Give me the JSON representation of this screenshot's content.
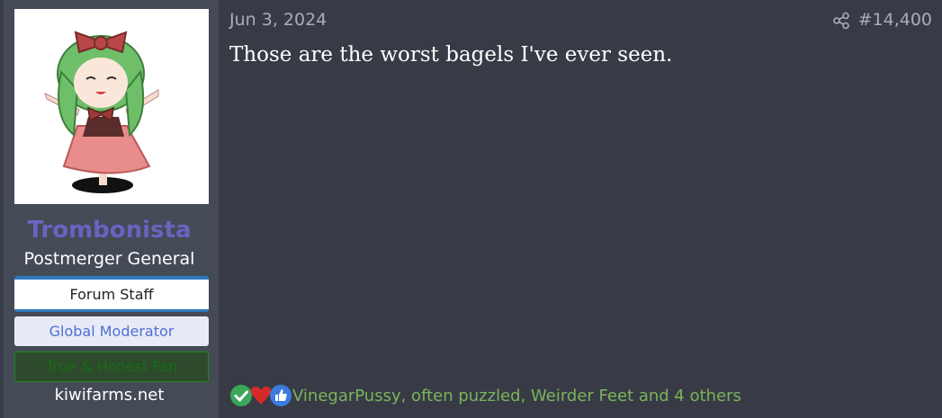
{
  "user": {
    "name": "Trombonista",
    "title": "Postmerger General",
    "banners": {
      "staff": "Forum Staff",
      "moderator": "Global Moderator",
      "fan": "True & Honest Fan"
    },
    "domain": "kiwifarms.net",
    "avatar_icon": "anime-girl-avatar"
  },
  "post": {
    "date": "Jun 3, 2024",
    "number": "#14,400",
    "message": "Those are the worst bagels I've ever seen.",
    "share_icon": "share-icon"
  },
  "reactions": {
    "icons": [
      "check-icon",
      "heart-icon",
      "thumbs-up-icon"
    ],
    "users": "VinegarPussy, often puzzled, Weirder Feet and 4 others"
  },
  "colors": {
    "background": "#383b45",
    "sidebar": "#454a57",
    "username": "#6a63c0",
    "reaction_text": "#7ab45b",
    "staff_accent": "#2d79c0"
  }
}
